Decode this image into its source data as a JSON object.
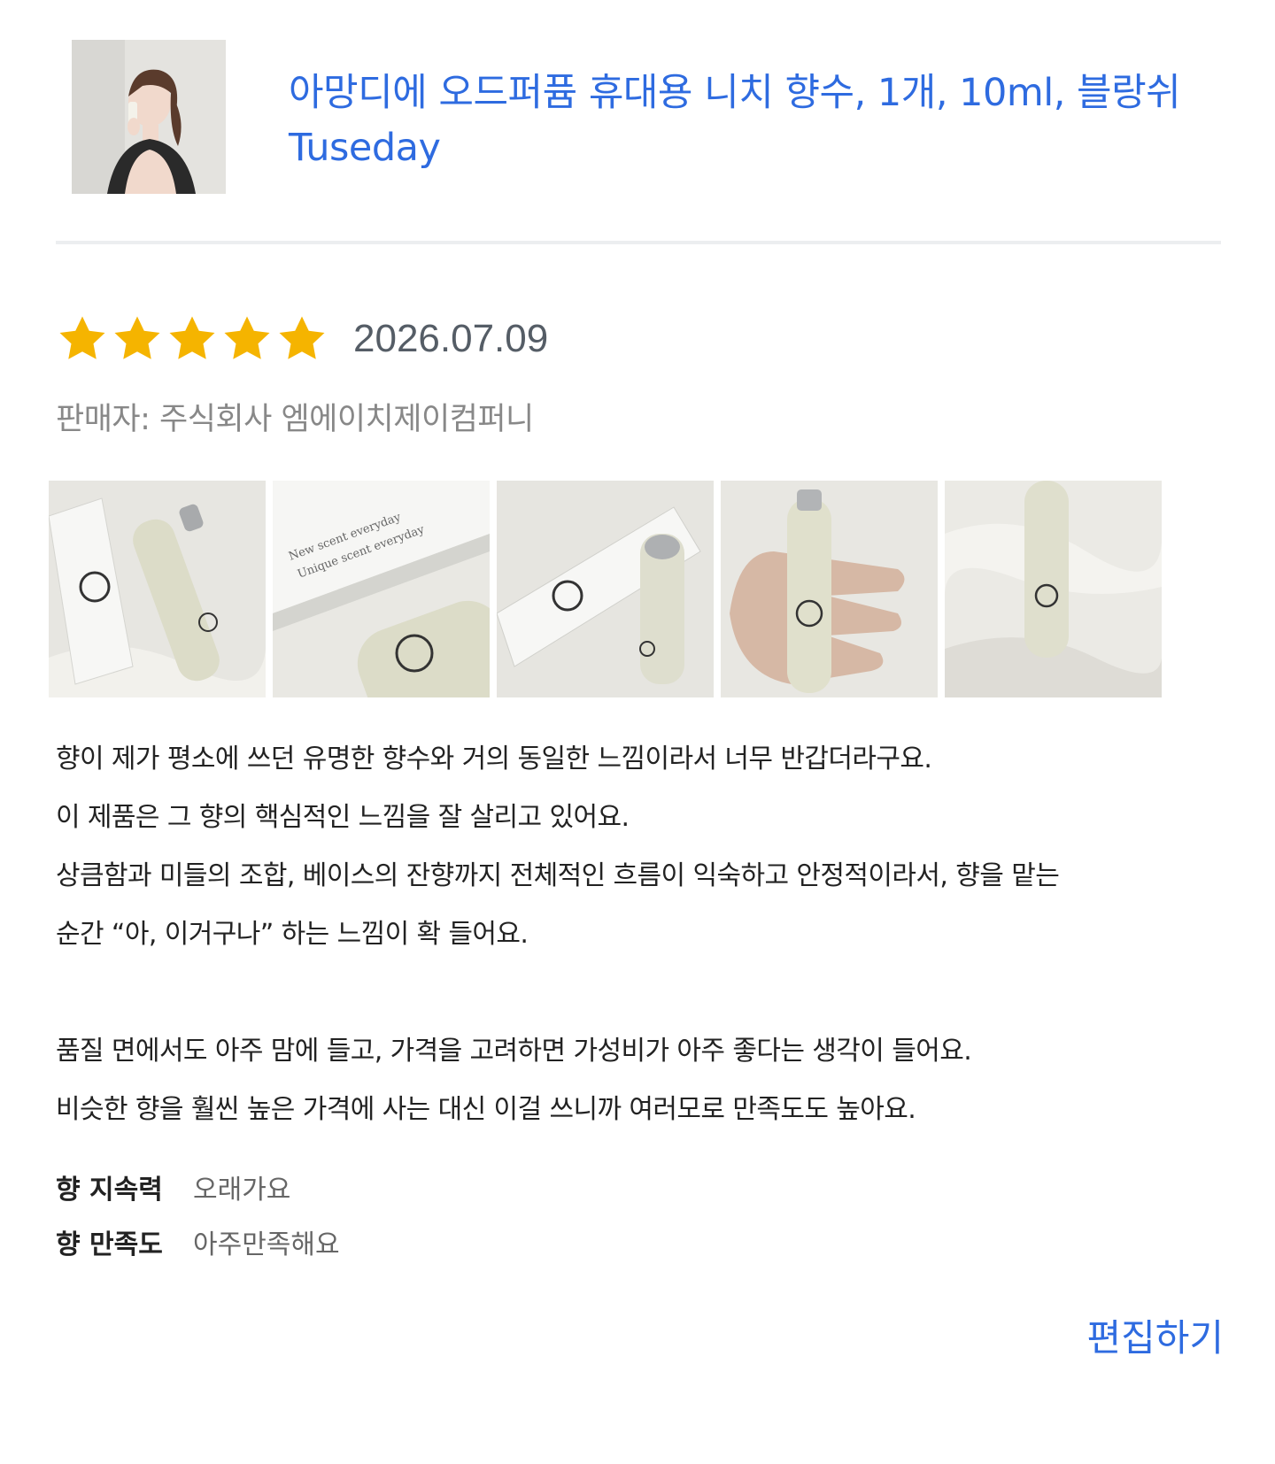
{
  "product": {
    "title_line1": "아망디에 오드퍼퓸 휴대용 니치 향수, 1개, 10ml, 블랑쉬",
    "title_line2": "Tuseday"
  },
  "review": {
    "rating": 5,
    "rating_max": 5,
    "date": "2026.07.09",
    "seller": "판매자: 주식회사 엠에이치제이컴퍼니",
    "photo_count": 5,
    "body_lines": [
      "향이 제가 평소에 쓰던 유명한 향수와 거의 동일한 느낌이라서 너무 반갑더라구요.",
      "이 제품은 그 향의 핵심적인 느낌을 잘 살리고 있어요.",
      "상큼함과 미들의 조합,  베이스의 잔향까지 전체적인 흐름이 익숙하고 안정적이라서, 향을 맡는",
      "순간 “아, 이거구나” 하는 느낌이 확 들어요.",
      "",
      "품질 면에서도 아주 맘에 들고, 가격을 고려하면 가성비가 아주 좋다는 생각이 들어요.",
      "비슷한 향을 훨씬 높은 가격에 사는 대신 이걸 쓰니까 여러모로 만족도도 높아요."
    ],
    "attributes": [
      {
        "label": "향 지속력",
        "value": "오래가요"
      },
      {
        "label": "향 만족도",
        "value": "아주만족해요"
      }
    ]
  },
  "actions": {
    "edit_label": "편집하기"
  },
  "colors": {
    "link": "#2e6be0",
    "star": "#f5b400",
    "divider": "#eceef0"
  }
}
